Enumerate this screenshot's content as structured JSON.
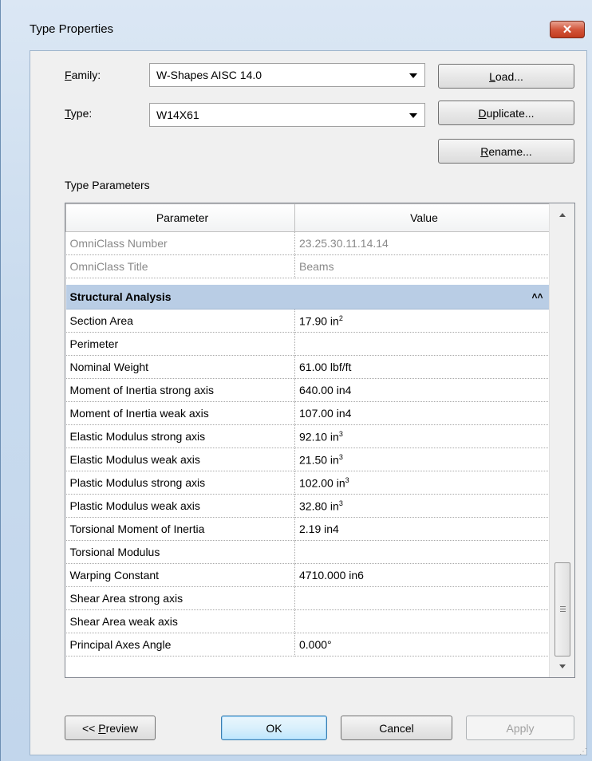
{
  "window": {
    "title": "Type Properties",
    "close_label": "✕"
  },
  "family": {
    "label_first": "F",
    "label_rest": "amily:",
    "value": "W-Shapes AISC 14.0"
  },
  "type": {
    "label_first": "T",
    "label_rest": "ype:",
    "value": "W14X61"
  },
  "buttons": {
    "load": {
      "first": "L",
      "rest": "oad..."
    },
    "duplicate": {
      "first": "D",
      "rest": "uplicate..."
    },
    "rename_pre": "",
    "rename_u": "R",
    "rename_rest": "ename...",
    "preview_pre": "<< ",
    "preview_u": "P",
    "preview_rest": "review",
    "ok": "OK",
    "cancel": "Cancel",
    "apply": "Apply"
  },
  "section_label": "Type Parameters",
  "table": {
    "headers": [
      "Parameter",
      "Value"
    ],
    "identity_rows": [
      {
        "param": "OmniClass Number",
        "value": "23.25.30.11.14.14"
      },
      {
        "param": "OmniClass Title",
        "value": "Beams"
      }
    ],
    "group": {
      "name": "Structural Analysis",
      "collapse_icon": "double-chevron-up"
    },
    "rows": [
      {
        "param": "Section Area",
        "value": "17.90 in",
        "sup": "2"
      },
      {
        "param": "Perimeter",
        "value": "",
        "sup": ""
      },
      {
        "param": "Nominal Weight",
        "value": "61.00 lbf/ft",
        "sup": ""
      },
      {
        "param": "Moment of Inertia strong axis",
        "value": "640.00 in4",
        "sup": ""
      },
      {
        "param": "Moment of Inertia weak axis",
        "value": "107.00 in4",
        "sup": ""
      },
      {
        "param": "Elastic Modulus strong axis",
        "value": "92.10 in",
        "sup": "3"
      },
      {
        "param": "Elastic Modulus weak axis",
        "value": "21.50 in",
        "sup": "3"
      },
      {
        "param": "Plastic Modulus strong axis",
        "value": "102.00 in",
        "sup": "3"
      },
      {
        "param": "Plastic Modulus weak axis",
        "value": "32.80 in",
        "sup": "3"
      },
      {
        "param": "Torsional Moment of Inertia",
        "value": "2.19 in4",
        "sup": ""
      },
      {
        "param": "Torsional Modulus",
        "value": "",
        "sup": ""
      },
      {
        "param": "Warping Constant",
        "value": "4710.000 in6",
        "sup": ""
      },
      {
        "param": "Shear Area strong axis",
        "value": "",
        "sup": ""
      },
      {
        "param": "Shear Area weak axis",
        "value": "",
        "sup": ""
      },
      {
        "param": "Principal Axes Angle",
        "value": "0.000°",
        "sup": ""
      }
    ]
  },
  "colors": {
    "group_header": "#b9cde5",
    "close_button": "#c23b1e",
    "default_button": "#3c7fb1"
  }
}
